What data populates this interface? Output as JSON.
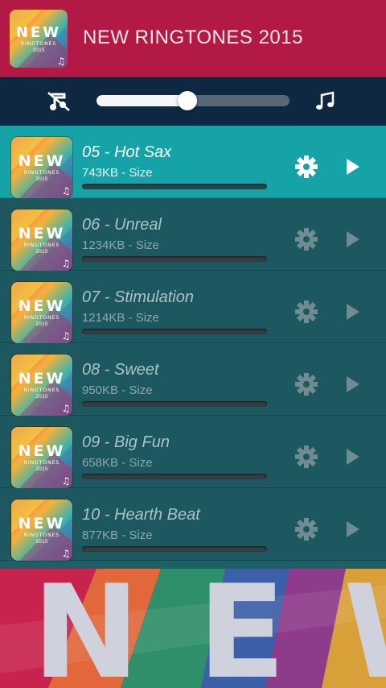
{
  "app": {
    "title": "NEW RINGTONES 2015"
  },
  "logo": {
    "word": "NEW",
    "sub": "RINGTONES",
    "year": "2015"
  },
  "volume": {
    "level": 0.47
  },
  "tracks": [
    {
      "title": "05 - Hot Sax",
      "size": "743KB - Size",
      "active": true
    },
    {
      "title": "06 - Unreal",
      "size": "1234KB - Size",
      "active": false
    },
    {
      "title": "07 - Stimulation",
      "size": "1214KB - Size",
      "active": false
    },
    {
      "title": "08 - Sweet",
      "size": "950KB - Size",
      "active": false
    },
    {
      "title": "09 - Big Fun",
      "size": "658KB - Size",
      "active": false
    },
    {
      "title": "10 - Hearth Beat",
      "size": "877KB - Size",
      "active": false
    }
  ],
  "banner": {
    "text": "NEW"
  },
  "icons": {
    "mute": "mute-icon",
    "note": "music-note-icon",
    "settings": "gear-icon",
    "play": "play-icon"
  },
  "colors": {
    "header": "#b21a45",
    "volume_bar": "#0e2842",
    "row": "#1d575f",
    "row_active": "#16a3a8"
  }
}
